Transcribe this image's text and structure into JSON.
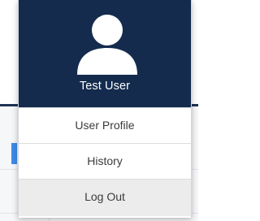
{
  "colors": {
    "header_background": "#142b4e",
    "avatar_fill": "#ffffff",
    "logout_background": "#ececec"
  },
  "user": {
    "name": "Test User",
    "avatar_icon": "user-silhouette-icon"
  },
  "menu": {
    "items": [
      {
        "label": "User Profile"
      },
      {
        "label": "History"
      },
      {
        "label": "Log Out"
      }
    ]
  }
}
